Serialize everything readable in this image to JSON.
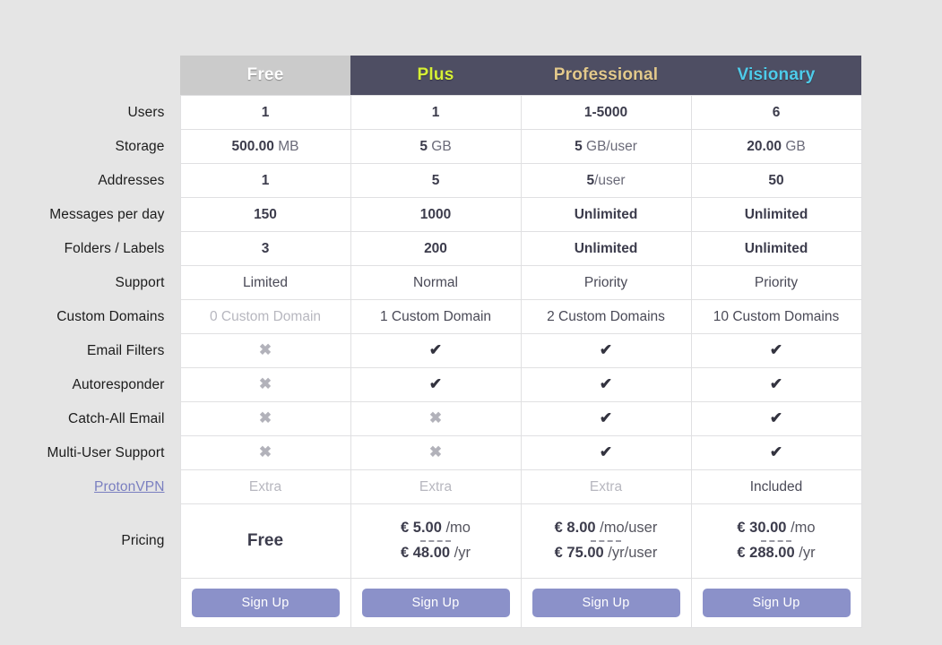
{
  "table": {
    "plans": [
      {
        "id": "free",
        "label": "Free"
      },
      {
        "id": "plus",
        "label": "Plus"
      },
      {
        "id": "professional",
        "label": "Professional"
      },
      {
        "id": "visionary",
        "label": "Visionary"
      }
    ],
    "plan_colors": {
      "free_bg": "#cbcbcb",
      "free_text": "#ffffff",
      "dark_bg": "#4e4e63",
      "plus_text": "#d6f035",
      "professional_text": "#e3c98c",
      "visionary_text": "#4ecbea"
    },
    "rows": [
      {
        "label": "Users",
        "cells": [
          {
            "value": "1"
          },
          {
            "value": "1"
          },
          {
            "value": "1-5000"
          },
          {
            "value": "6"
          }
        ]
      },
      {
        "label": "Storage",
        "cells": [
          {
            "value": "500.00",
            "unit": " MB"
          },
          {
            "value": "5",
            "unit": " GB"
          },
          {
            "value": "5",
            "unit": " GB/user"
          },
          {
            "value": "20.00",
            "unit": " GB"
          }
        ]
      },
      {
        "label": "Addresses",
        "cells": [
          {
            "value": "1"
          },
          {
            "value": "5"
          },
          {
            "value": "5",
            "unit": "/user"
          },
          {
            "value": "50"
          }
        ]
      },
      {
        "label": "Messages per day",
        "cells": [
          {
            "value": "150"
          },
          {
            "value": "1000"
          },
          {
            "value": "Unlimited"
          },
          {
            "value": "Unlimited"
          }
        ]
      },
      {
        "label": "Folders / Labels",
        "cells": [
          {
            "value": "3"
          },
          {
            "value": "200"
          },
          {
            "value": "Unlimited"
          },
          {
            "value": "Unlimited"
          }
        ]
      },
      {
        "label": "Support",
        "style": "regular",
        "cells": [
          {
            "value": "Limited"
          },
          {
            "value": "Normal"
          },
          {
            "value": "Priority"
          },
          {
            "value": "Priority"
          }
        ]
      },
      {
        "label": "Custom Domains",
        "style": "regular",
        "cells": [
          {
            "value": "0 Custom Domain",
            "style": "muted"
          },
          {
            "value": "1 Custom Domain"
          },
          {
            "value": "2 Custom Domains"
          },
          {
            "value": "10 Custom Domains"
          }
        ]
      },
      {
        "label": "Email Filters",
        "cells": [
          {
            "icon": "cross-icon",
            "glyph": "✖"
          },
          {
            "icon": "check-icon",
            "glyph": "✔"
          },
          {
            "icon": "check-icon",
            "glyph": "✔"
          },
          {
            "icon": "check-icon",
            "glyph": "✔"
          }
        ]
      },
      {
        "label": "Autoresponder",
        "cells": [
          {
            "icon": "cross-icon",
            "glyph": "✖"
          },
          {
            "icon": "check-icon",
            "glyph": "✔"
          },
          {
            "icon": "check-icon",
            "glyph": "✔"
          },
          {
            "icon": "check-icon",
            "glyph": "✔"
          }
        ]
      },
      {
        "label": "Catch-All Email",
        "cells": [
          {
            "icon": "cross-icon",
            "glyph": "✖"
          },
          {
            "icon": "cross-icon",
            "glyph": "✖"
          },
          {
            "icon": "check-icon",
            "glyph": "✔"
          },
          {
            "icon": "check-icon",
            "glyph": "✔"
          }
        ]
      },
      {
        "label": "Multi-User Support",
        "cells": [
          {
            "icon": "cross-icon",
            "glyph": "✖"
          },
          {
            "icon": "cross-icon",
            "glyph": "✖"
          },
          {
            "icon": "check-icon",
            "glyph": "✔"
          },
          {
            "icon": "check-icon",
            "glyph": "✔"
          }
        ]
      },
      {
        "label": "ProtonVPN",
        "label_is_link": true,
        "style": "regular",
        "cells": [
          {
            "value": "Extra",
            "style": "muted"
          },
          {
            "value": "Extra",
            "style": "muted"
          },
          {
            "value": "Extra",
            "style": "muted"
          },
          {
            "value": "Included"
          }
        ]
      }
    ],
    "pricing": {
      "label": "Pricing",
      "cells": [
        {
          "free_text": "Free"
        },
        {
          "monthly_amount": "€ 5.00",
          "monthly_per": " /mo",
          "yearly_amount": "€ 48.00",
          "yearly_per": " /yr"
        },
        {
          "monthly_amount": "€ 8.00",
          "monthly_per": " /mo/user",
          "yearly_amount": "€ 75.00",
          "yearly_per": " /yr/user"
        },
        {
          "monthly_amount": "€ 30.00",
          "monthly_per": " /mo",
          "yearly_amount": "€ 288.00",
          "yearly_per": " /yr"
        }
      ]
    },
    "signup": {
      "labels": [
        "Sign Up",
        "Sign Up",
        "Sign Up",
        "Sign Up"
      ],
      "button_color": "#8b91c9"
    }
  }
}
